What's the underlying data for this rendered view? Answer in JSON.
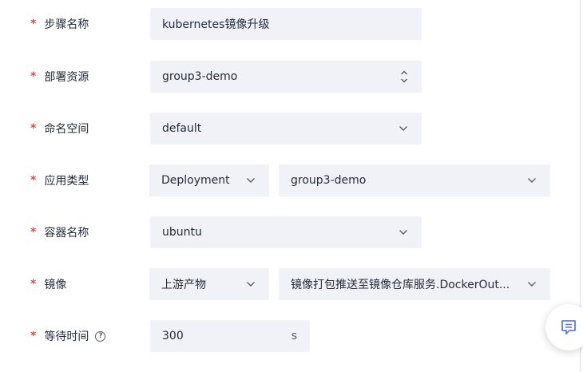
{
  "form": {
    "step_name": {
      "label": "步骤名称",
      "value": "kubernetes镜像升级"
    },
    "deploy_resource": {
      "label": "部署资源",
      "value": "group3-demo"
    },
    "namespace": {
      "label": "命名空间",
      "value": "default"
    },
    "app_type": {
      "label": "应用类型",
      "type_value": "Deployment",
      "name_value": "group3-demo"
    },
    "container_name": {
      "label": "容器名称",
      "value": "ubuntu"
    },
    "image": {
      "label": "镜像",
      "source_value": "上游产物",
      "artifact_value": "镜像打包推送至镜像仓库服务.DockerOut..."
    },
    "wait_time": {
      "label": "等待时间",
      "value": "300",
      "unit": "s",
      "help_glyph": "?"
    }
  },
  "required_marker": "*",
  "icons": {
    "select_arrow": "chevron-down-icon",
    "spinner": "updown-chevron-icon",
    "help": "question-circle-icon",
    "feedback": "chat-feedback-icon"
  },
  "colors": {
    "required": "#e54545",
    "field_bg": "#f1f2f7",
    "accent": "#5e7ce0"
  }
}
